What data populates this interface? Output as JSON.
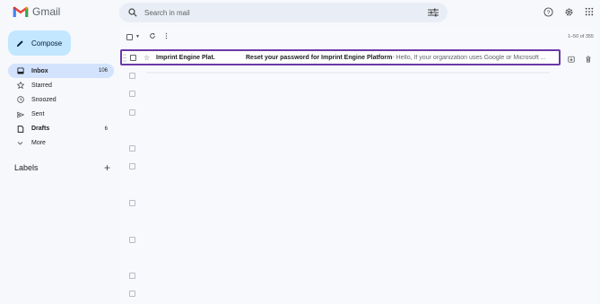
{
  "app": {
    "name": "Gmail",
    "brand_color": "#EA4335"
  },
  "search": {
    "placeholder": "Search in mail"
  },
  "header_icons": [
    "help-icon",
    "settings-icon",
    "apps-grid-icon"
  ],
  "compose": {
    "label": "Compose"
  },
  "sidebar": {
    "items": [
      {
        "label": "Inbox",
        "icon": "inbox-icon",
        "count": "106",
        "active": true,
        "bold": true
      },
      {
        "label": "Starred",
        "icon": "star-icon",
        "count": "",
        "active": false,
        "bold": false
      },
      {
        "label": "Snoozed",
        "icon": "clock-icon",
        "count": "",
        "active": false,
        "bold": false
      },
      {
        "label": "Sent",
        "icon": "send-icon",
        "count": "",
        "active": false,
        "bold": false
      },
      {
        "label": "Drafts",
        "icon": "draft-icon",
        "count": "6",
        "active": false,
        "bold": true
      },
      {
        "label": "More",
        "icon": "chevron-down-icon",
        "count": "",
        "active": false,
        "bold": false
      }
    ],
    "labels_heading": "Labels",
    "labels_add": "+"
  },
  "toolbar": {
    "pagination": "1–50 of 355"
  },
  "emails": [
    {
      "sender": "Imprint Engine Plat.",
      "subject": "Reset your password for Imprint Engine Platform",
      "snippet": " - Hello, If your organization uses Google or Microsoft ...",
      "highlight_color": "#6A3AA8"
    }
  ]
}
